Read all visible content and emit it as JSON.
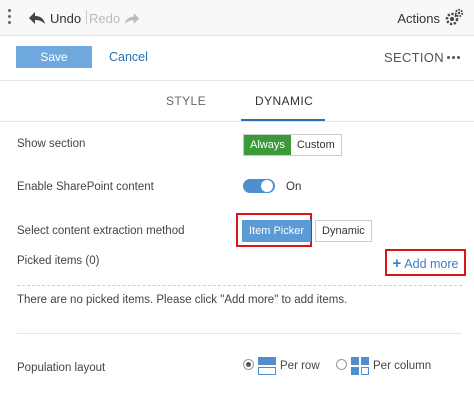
{
  "toolbar": {
    "undo_label": "Undo",
    "redo_label": "Redo",
    "actions_label": "Actions"
  },
  "header": {
    "save_label": "Save",
    "cancel_label": "Cancel",
    "title": "SECTION"
  },
  "tabs": [
    {
      "label": "STYLE",
      "active": false
    },
    {
      "label": "DYNAMIC",
      "active": true
    }
  ],
  "show_section": {
    "label": "Show section",
    "options": [
      "Always",
      "Custom"
    ],
    "selected": "Always"
  },
  "sharepoint": {
    "label": "Enable SharePoint content",
    "toggle_on": true,
    "state_label": "On"
  },
  "extraction": {
    "label": "Select content extraction method",
    "options": [
      "Item Picker",
      "Dynamic"
    ],
    "selected": "Item Picker"
  },
  "picked_items": {
    "label": "Picked items (0)",
    "add_more_label": "Add more",
    "empty_message": "There are no picked items. Please click \"Add more\" to add items."
  },
  "population_layout": {
    "label": "Population layout",
    "options": [
      {
        "label": "Per row",
        "icon": "per-row-icon",
        "checked": true
      },
      {
        "label": "Per column",
        "icon": "per-column-icon",
        "checked": false
      }
    ]
  },
  "colors": {
    "primary": "#6fa8dc",
    "link": "#2a6fb0",
    "active_green": "#3a9a3a",
    "highlight_red": "#d9141a"
  }
}
